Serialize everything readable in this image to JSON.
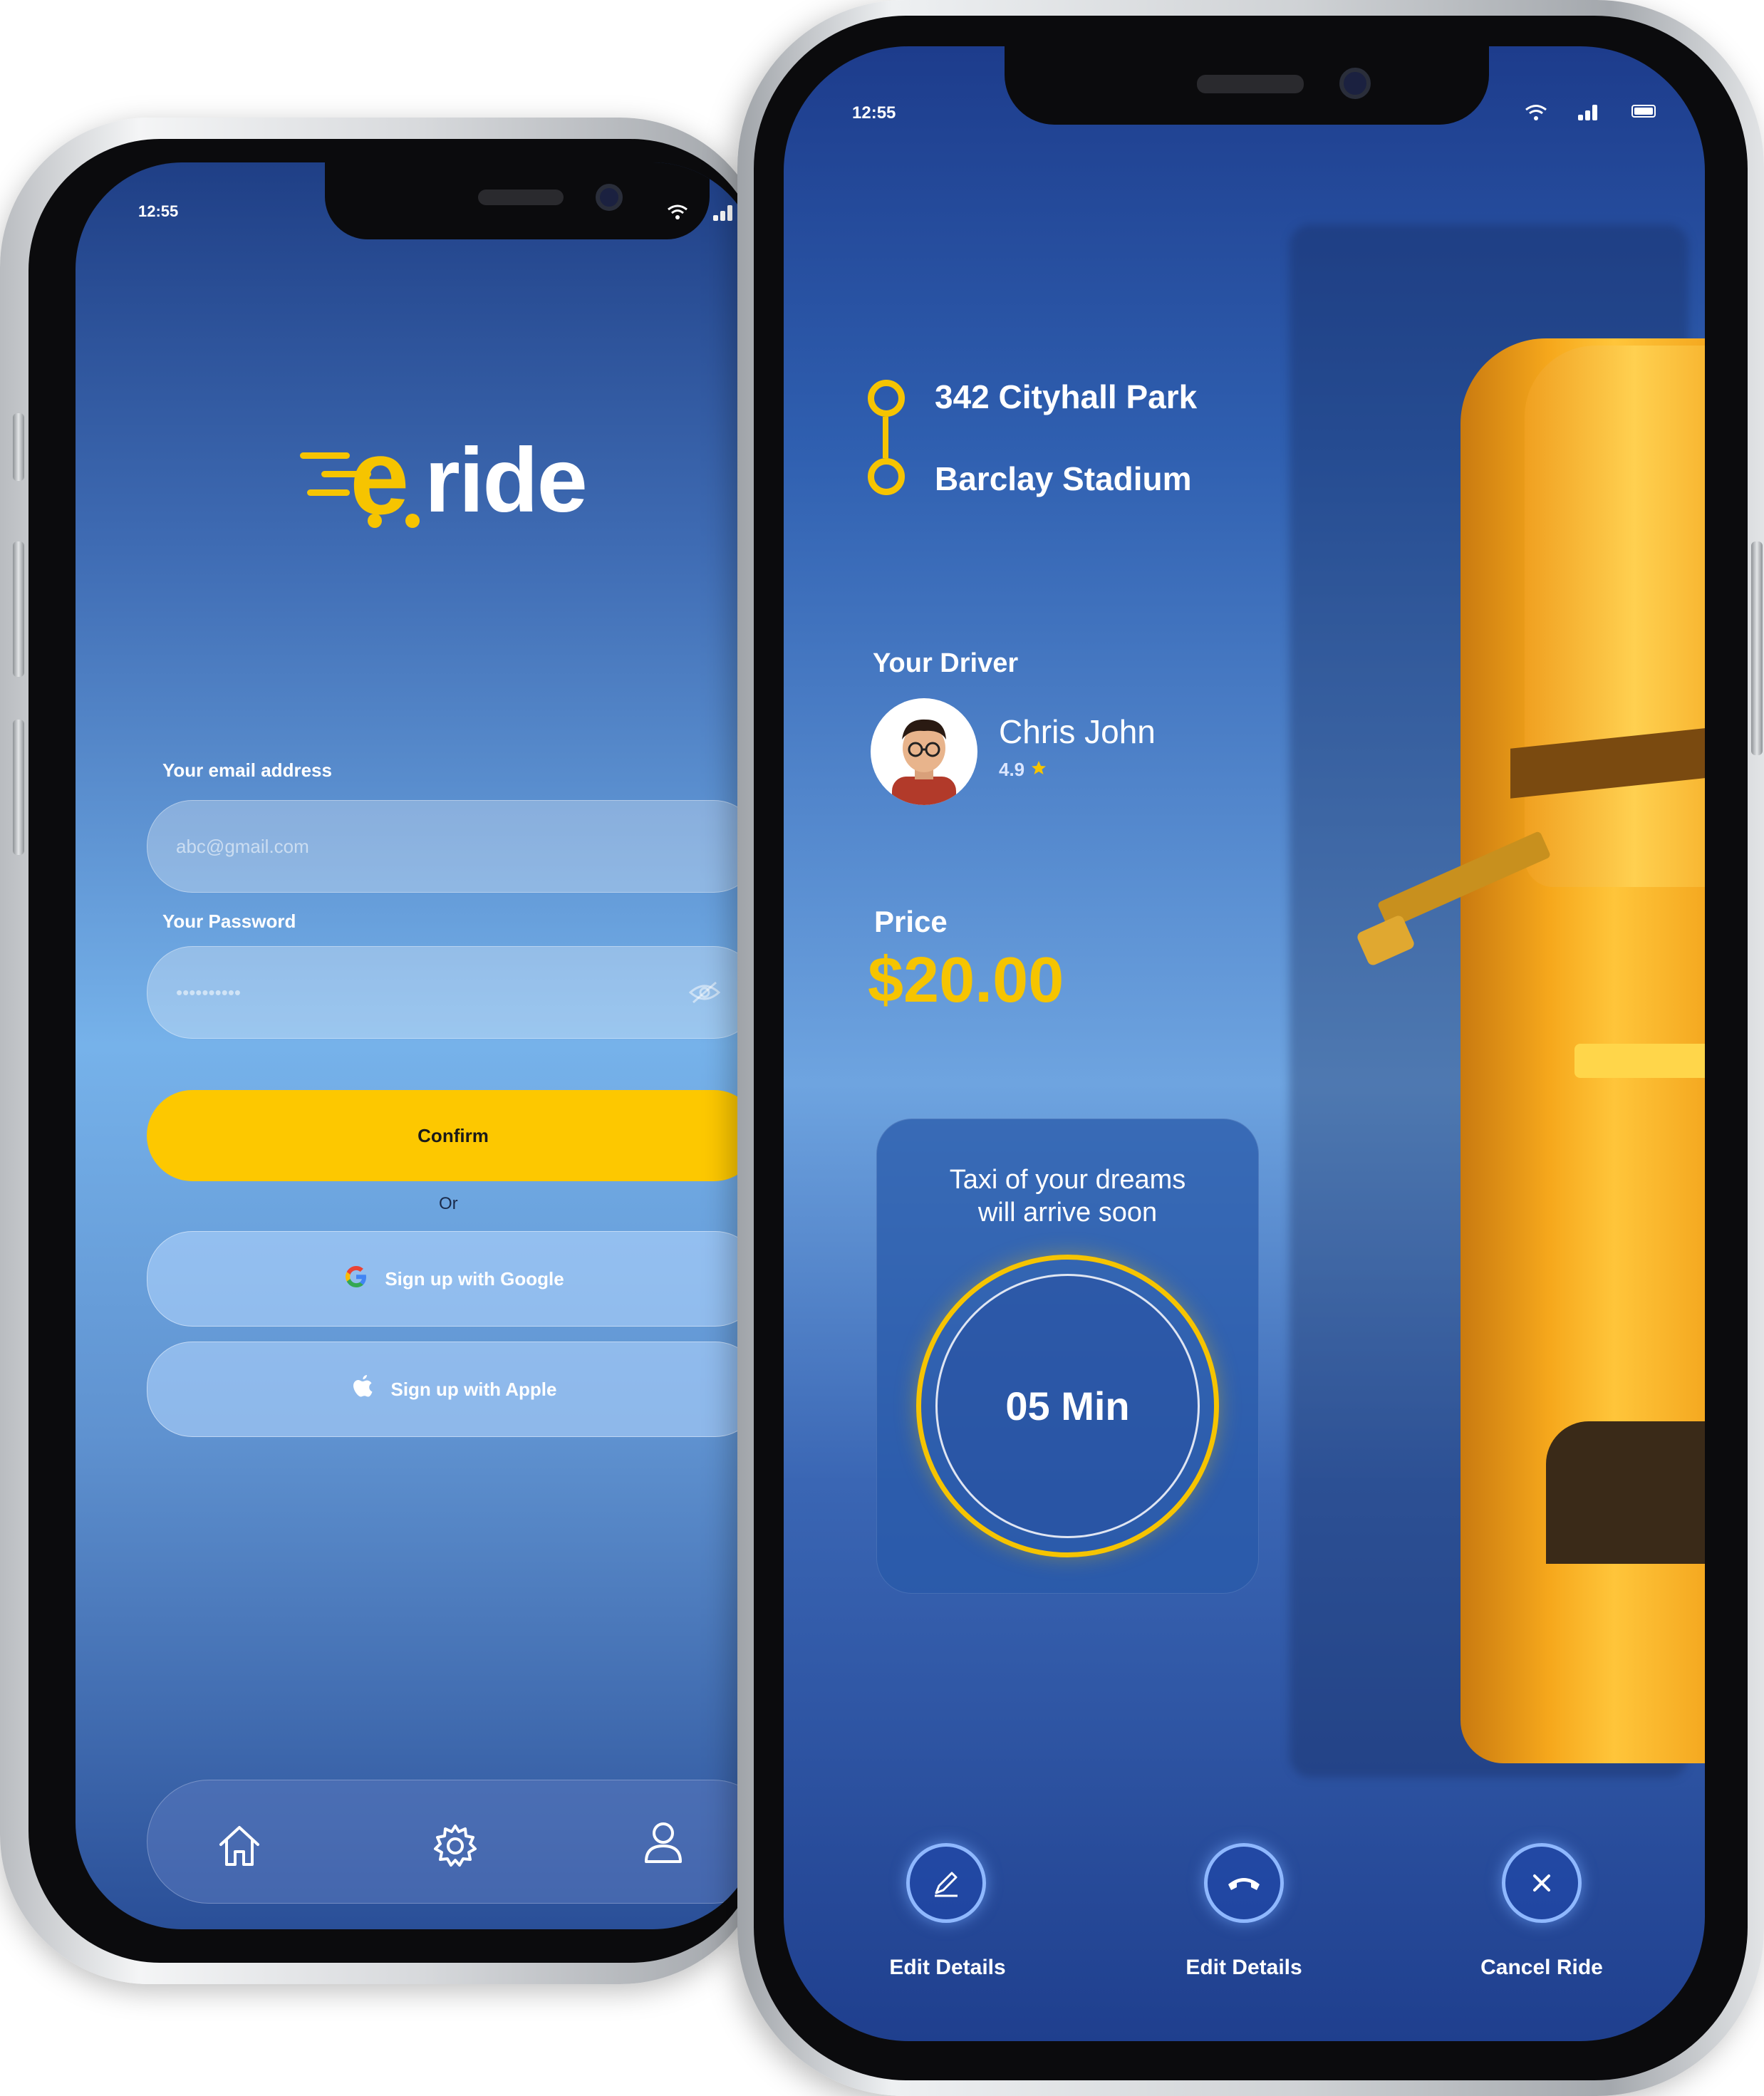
{
  "login_screen": {
    "status_time": "12:55",
    "logo": {
      "mark": "e",
      "text": "ride"
    },
    "email": {
      "label": "Your email address",
      "placeholder": "abc@gmail.com"
    },
    "password": {
      "label": "Your Password",
      "placeholder": "••••••••••"
    },
    "confirm_label": "Confirm",
    "or_label": "Or",
    "google_label": "Sign up with Google",
    "apple_label": "Sign up with Apple",
    "nav": [
      "home-icon",
      "gear-icon",
      "user-icon"
    ]
  },
  "ride_screen": {
    "status_time": "12:55",
    "route": {
      "pickup": "342 Cityhall Park",
      "dropoff": "Barclay Stadium"
    },
    "driver": {
      "section_title": "Your Driver",
      "name": "Chris John",
      "rating": "4.9"
    },
    "price": {
      "label": "Price",
      "value": "$20.00"
    },
    "eta": {
      "message_line1": "Taxi of your dreams",
      "message_line2": "will arrive soon",
      "time": "05 Min"
    },
    "actions": [
      {
        "label": "Edit Details",
        "icon": "pencil-icon"
      },
      {
        "label": "Edit Details",
        "icon": "phone-icon"
      },
      {
        "label": "Cancel Ride",
        "icon": "close-icon"
      }
    ]
  },
  "colors": {
    "accent": "#f6c400",
    "primary": "#1d3c8c",
    "button_yellow": "#fdc800"
  }
}
